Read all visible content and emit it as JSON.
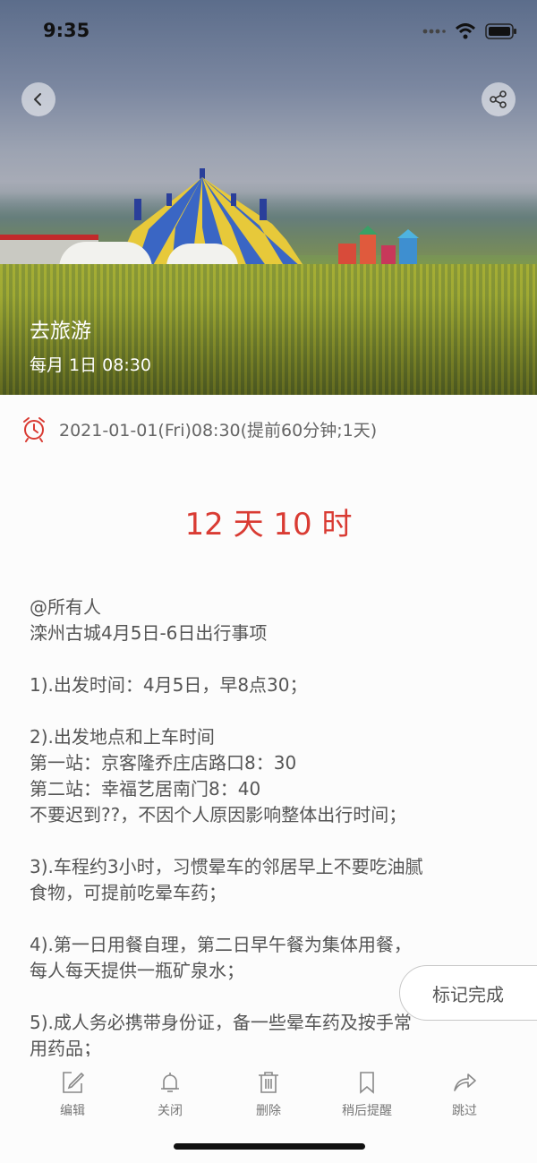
{
  "status_bar": {
    "time": "9:35"
  },
  "header": {
    "title": "去旅游",
    "schedule": "每月 1日 08:30"
  },
  "icons": {
    "back": "chevron-left-icon",
    "share": "share-icon",
    "alarm": "alarm-clock-icon",
    "edit": "edit-icon",
    "close": "bell-icon",
    "delete": "trash-icon",
    "remind_later": "bookmark-icon",
    "skip": "forward-arrow-icon"
  },
  "reminder": {
    "datetime": "2021-01-01(Fri)08:30(提前60分钟;1天)"
  },
  "countdown": "12 天 10 时",
  "content": {
    "lines": [
      "@所有人",
      "滦州古城4月5日-6日出行事项",
      "",
      "1).出发时间：4月5日，早8点30；",
      "",
      "2).出发地点和上车时间",
      "第一站：京客隆乔庄店路口8：30",
      "第二站：幸福艺居南门8：40",
      "不要迟到??，不因个人原因影响整体出行时间；",
      "",
      "3).车程约3小时，习惯晕车的邻居早上不要吃油腻",
      "食物，可提前吃晕车药；",
      "",
      "4).第一日用餐自理，第二日早午餐为集体用餐，",
      "每人每天提供一瓶矿泉水；",
      "",
      "5).成人务必携带身份证，备一些晕车药及按手常",
      "用药品；"
    ]
  },
  "mark_done_label": "标记完成",
  "toolbar": {
    "edit": "编辑",
    "close": "关闭",
    "delete": "删除",
    "remind_later": "稍后提醒",
    "skip": "跳过"
  },
  "colors": {
    "accent_red": "#d93b33",
    "text_gray": "#555555"
  }
}
